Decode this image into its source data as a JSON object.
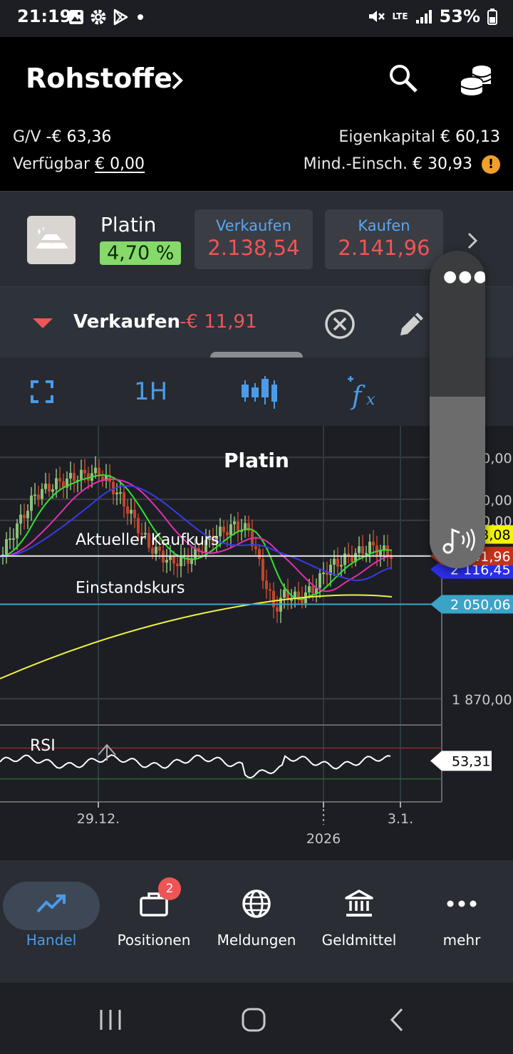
{
  "status_bar": {
    "time": "21:19",
    "battery": "53%",
    "network": "LTE"
  },
  "header": {
    "title": "Rohstoffe",
    "gv_label": "G/V",
    "gv_value": "-€ 63,36",
    "verfuegbar_label": "Verfügbar",
    "verfuegbar_value": "€ 0,00",
    "eigenkapital_label": "Eigenkapital",
    "eigenkapital_value": "€ 60,13",
    "mind_label": "Mind.-Einsch.",
    "mind_value": "€ 30,93"
  },
  "instrument": {
    "name": "Platin",
    "change": "4,70 %",
    "sell_label": "Verkaufen",
    "sell_price": "2.138,54",
    "buy_label": "Kaufen",
    "buy_price": "2.141,96"
  },
  "order": {
    "label": "Verkaufen",
    "value": "-€ 11,91"
  },
  "chart_toolbar": {
    "timeframe": "1H"
  },
  "chart_data": {
    "type": "candlestick",
    "title": "Platin",
    "y_ticks": [
      {
        "v": 2330,
        "label": "2 330,00"
      },
      {
        "v": 2250,
        "label": "2 250,00"
      },
      {
        "v": 2210,
        "label": "2 210,00"
      },
      {
        "v": 1870,
        "label": "1 870,00"
      }
    ],
    "ylim": [
      1820,
      2390
    ],
    "x_ticks": [
      "29.12.",
      "2026",
      "3.1."
    ],
    "lines": [
      {
        "label": "Aktueller Kaufkurs",
        "value": 2141.96,
        "tag": "2 141,96",
        "color": "#c4321a"
      },
      {
        "label": "Einstandskurs",
        "value": 2050.06,
        "tag": "2 050,06",
        "color": "#3aa4c8"
      }
    ],
    "ma_tags": [
      {
        "tag": "2 183,08",
        "value": 2183.08,
        "color": "#f5f50a"
      },
      {
        "tag": "2 116,45",
        "value": 2116.45,
        "color": "#2a2ee8"
      }
    ],
    "rsi": {
      "label": "RSI",
      "value": "53,31",
      "upper": 70,
      "lower": 30
    }
  },
  "volume_panel": {
    "level": 0.54
  },
  "bottom_nav": {
    "items": [
      {
        "label": "Handel"
      },
      {
        "label": "Positionen",
        "badge": "2"
      },
      {
        "label": "Meldungen"
      },
      {
        "label": "Geldmittel"
      },
      {
        "label": "mehr"
      }
    ]
  }
}
